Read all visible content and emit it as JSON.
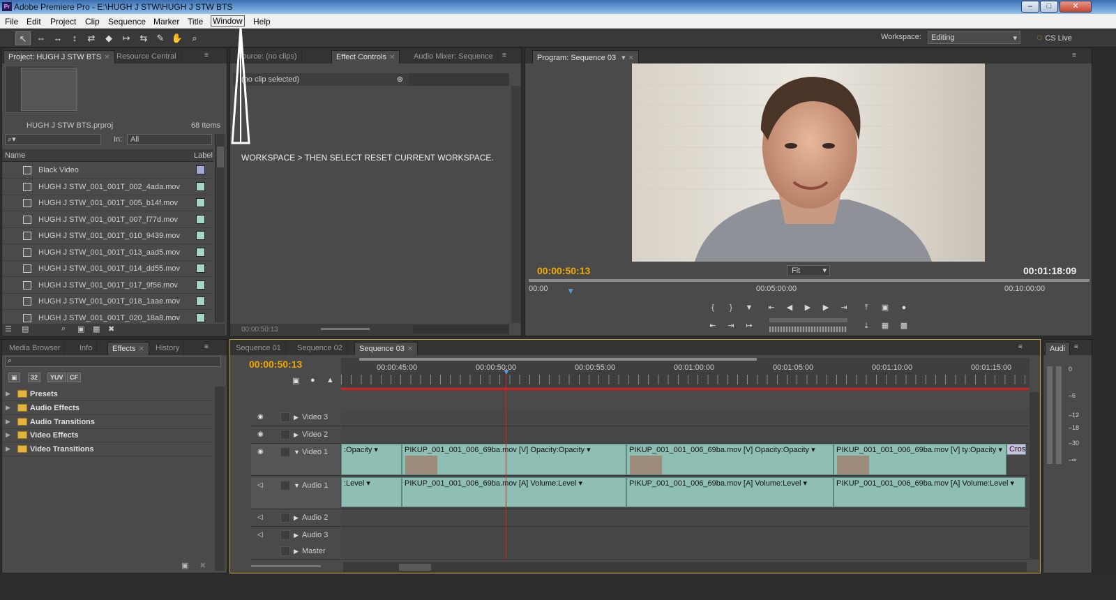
{
  "titlebar": {
    "title": "Adobe Premiere Pro - E:\\HUGH J STW\\HUGH J STW BTS",
    "app_icon_text": "Pr",
    "minimize": "–",
    "maximize": "□",
    "close": "✕"
  },
  "menu": {
    "file": "File",
    "edit": "Edit",
    "project": "Project",
    "clip": "Clip",
    "sequence": "Sequence",
    "marker": "Marker",
    "title": "Title",
    "window": "Window",
    "help": "Help"
  },
  "toolbar": {
    "workspace_label": "Workspace:",
    "workspace_value": "Editing",
    "cs_live": "CS Live"
  },
  "project": {
    "tab_active": "Project: HUGH J STW BTS",
    "tab_other": "Resource Central",
    "file_name": "HUGH J STW BTS.prproj",
    "item_count": "68 Items",
    "in_label": "In:",
    "in_value": "All",
    "col_name": "Name",
    "col_label": "Label",
    "items": [
      {
        "name": "Black Video",
        "color": "#a8a8d8"
      },
      {
        "name": "HUGH J STW_001_001T_002_4ada.mov",
        "color": "#a6d6c8"
      },
      {
        "name": "HUGH J STW_001_001T_005_b14f.mov",
        "color": "#a6d6c8"
      },
      {
        "name": "HUGH J STW_001_001T_007_f77d.mov",
        "color": "#a6d6c8"
      },
      {
        "name": "HUGH J STW_001_001T_010_9439.mov",
        "color": "#a6d6c8"
      },
      {
        "name": "HUGH J STW_001_001T_013_aad5.mov",
        "color": "#a6d6c8"
      },
      {
        "name": "HUGH J STW_001_001T_014_dd55.mov",
        "color": "#a6d6c8"
      },
      {
        "name": "HUGH J STW_001_001T_017_9f56.mov",
        "color": "#a6d6c8"
      },
      {
        "name": "HUGH J STW_001_001T_018_1aae.mov",
        "color": "#a6d6c8"
      },
      {
        "name": "HUGH J STW_001_001T_020_18a8.mov",
        "color": "#a6d6c8"
      }
    ]
  },
  "source": {
    "tab_source": "Source: (no clips)",
    "tab_effect_controls": "Effect Controls",
    "tab_audio_mixer": "Audio Mixer: Sequence",
    "no_clip": "(no clip selected)",
    "timecode": "00:00:50:13",
    "annotation": "WORKSPACE > THEN SELECT RESET CURRENT WORKSPACE."
  },
  "program": {
    "tab": "Program: Sequence 03",
    "current_time": "00:00:50:13",
    "duration": "00:01:18:09",
    "fit": "Fit",
    "ruler": [
      "00:00",
      "00:05:00:00",
      "00:10:00:00"
    ],
    "playhead_fraction": 0.075
  },
  "effects": {
    "tab_media_browser": "Media Browser",
    "tab_info": "Info",
    "tab_effects": "Effects",
    "tab_history": "History",
    "badges": [
      "32",
      "YUV",
      "CF"
    ],
    "folders": [
      "Presets",
      "Audio Effects",
      "Audio Transitions",
      "Video Effects",
      "Video Transitions"
    ]
  },
  "timeline": {
    "tabs": [
      "Sequence 01",
      "Sequence 02",
      "Sequence 03"
    ],
    "current_time": "00:00:50:13",
    "ruler": [
      "00:00:45:00",
      "00:00:50:00",
      "00:00:55:00",
      "00:01:00:00",
      "00:01:05:00",
      "00:01:10:00",
      "00:01:15:00"
    ],
    "tracks": {
      "v3": "Video 3",
      "v2": "Video 2",
      "v1": "Video 1",
      "a1": "Audio 1",
      "a2": "Audio 2",
      "a3": "Audio 3",
      "master": "Master"
    },
    "video_clips": [
      {
        "title": ":Opacity ▾"
      },
      {
        "title": "PIKUP_001_001_006_69ba.mov [V]  Opacity:Opacity ▾"
      },
      {
        "title": "PIKUP_001_001_006_69ba.mov [V]  Opacity:Opacity ▾"
      },
      {
        "title": "PIKUP_001_001_006_69ba.mov [V]  ty:Opacity ▾"
      },
      {
        "title": "Cros"
      }
    ],
    "audio_clips": [
      {
        "title": ":Level ▾"
      },
      {
        "title": "PIKUP_001_001_006_69ba.mov [A]  Volume:Level ▾"
      },
      {
        "title": "PIKUP_001_001_006_69ba.mov [A]  Volume:Level ▾"
      },
      {
        "title": "PIKUP_001_001_006_69ba.mov [A]  Volume:Level ▾"
      }
    ]
  },
  "audio_meter": {
    "tab": "Audi",
    "labels": [
      "0",
      "–6",
      "–12",
      "–18",
      "–30",
      "–∞"
    ]
  }
}
